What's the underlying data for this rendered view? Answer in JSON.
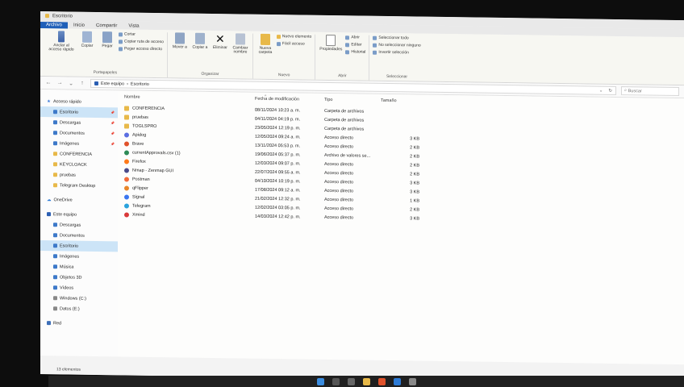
{
  "window": {
    "title": "Escritorio"
  },
  "tabs": [
    "Archivo",
    "Inicio",
    "Compartir",
    "Vista"
  ],
  "ribbon": {
    "portapapeles": {
      "name": "Portapapeles",
      "pin": "Anclar al acceso rápido",
      "copy": "Copiar",
      "paste": "Pegar",
      "cut": "Cortar",
      "copy_path": "Copiar ruta de acceso",
      "paste_shortcut": "Pegar acceso directo"
    },
    "organizar": {
      "name": "Organizar",
      "move": "Mover a",
      "copy_to": "Copiar a",
      "delete": "Eliminar",
      "rename": "Cambiar nombre"
    },
    "nuevo": {
      "name": "Nuevo",
      "new_folder": "Nueva carpeta",
      "new_item": "Nuevo elemento",
      "easy_access": "Fácil acceso"
    },
    "abrir": {
      "name": "Abrir",
      "properties": "Propiedades",
      "open": "Abrir",
      "edit": "Editar",
      "history": "Historial"
    },
    "seleccionar": {
      "name": "Seleccionar",
      "select_all": "Seleccionar todo",
      "select_none": "No seleccionar ninguno",
      "invert": "Invertir selección"
    }
  },
  "address": {
    "root": "Este equipo",
    "current": "Escritorio",
    "search_placeholder": "Buscar"
  },
  "nav": {
    "quick_access": "Acceso rápido",
    "quick_items": [
      "Escritorio",
      "Descargas",
      "Documentos",
      "Imágenes",
      "CONFERENCIA",
      "KEYCLOACK",
      "pruebas",
      "Telegram Desktop"
    ],
    "onedrive": "OneDrive",
    "this_pc": "Este equipo",
    "pc_items": [
      "Descargas",
      "Documentos",
      "Escritorio",
      "Imágenes",
      "Música",
      "Objetos 3D",
      "Vídeos",
      "Windows (C:)",
      "Datos (E:)"
    ],
    "network": "Red"
  },
  "columns": {
    "name": "Nombre",
    "date": "Fecha de modificación",
    "type": "Tipo",
    "size": "Tamaño"
  },
  "files": [
    {
      "name": "CONFERENCIA",
      "date": "08/11/2024 10:23 a. m.",
      "type": "Carpeta de archivos",
      "size": "",
      "icon": "folder-icon",
      "color": "#e8b949"
    },
    {
      "name": "pruebas",
      "date": "04/11/2024 04:19 p. m.",
      "type": "Carpeta de archivos",
      "size": "",
      "icon": "folder-icon",
      "color": "#e8b949"
    },
    {
      "name": "TOGLSPRO",
      "date": "23/05/2024 12:19 p. m.",
      "type": "Carpeta de archivos",
      "size": "",
      "icon": "folder-icon",
      "color": "#e8b949"
    },
    {
      "name": "Apidog",
      "date": "12/05/2024 09:24 a. m.",
      "type": "Acceso directo",
      "size": "3 KB",
      "icon": "app-icon",
      "color": "#5b6ee1"
    },
    {
      "name": "Brave",
      "date": "13/11/2024 05:53 p. m.",
      "type": "Acceso directo",
      "size": "2 KB",
      "icon": "brave-icon",
      "color": "#e0522b"
    },
    {
      "name": "currentApprovals.csv (1)",
      "date": "19/06/2024 05:37 p. m.",
      "type": "Archivo de valores se...",
      "size": "2 KB",
      "icon": "csv-icon",
      "color": "#2e8b57"
    },
    {
      "name": "Firefox",
      "date": "12/03/2024 09:07 p. m.",
      "type": "Acceso directo",
      "size": "2 KB",
      "icon": "firefox-icon",
      "color": "#ff7a1a"
    },
    {
      "name": "Nmap - Zenmap GUI",
      "date": "22/07/2024 09:55 a. m.",
      "type": "Acceso directo",
      "size": "2 KB",
      "icon": "nmap-icon",
      "color": "#4a4a8a"
    },
    {
      "name": "Postman",
      "date": "04/10/2024 10:19 p. m.",
      "type": "Acceso directo",
      "size": "3 KB",
      "icon": "postman-icon",
      "color": "#f26b3a"
    },
    {
      "name": "qFlipper",
      "date": "17/08/2024 09:12 a. m.",
      "type": "Acceso directo",
      "size": "3 KB",
      "icon": "qflipper-icon",
      "color": "#e8862a"
    },
    {
      "name": "Signal",
      "date": "21/02/2024 12:32 p. m.",
      "type": "Acceso directo",
      "size": "1 KB",
      "icon": "signal-icon",
      "color": "#3a76f0"
    },
    {
      "name": "Telegram",
      "date": "12/02/2024 03:05 p. m.",
      "type": "Acceso directo",
      "size": "2 KB",
      "icon": "telegram-icon",
      "color": "#2aa3dd"
    },
    {
      "name": "Xmind",
      "date": "14/03/2024 12:42 p. m.",
      "type": "Acceso directo",
      "size": "3 KB",
      "icon": "xmind-icon",
      "color": "#d93a3a"
    }
  ],
  "status": {
    "count": "13 elementos"
  }
}
